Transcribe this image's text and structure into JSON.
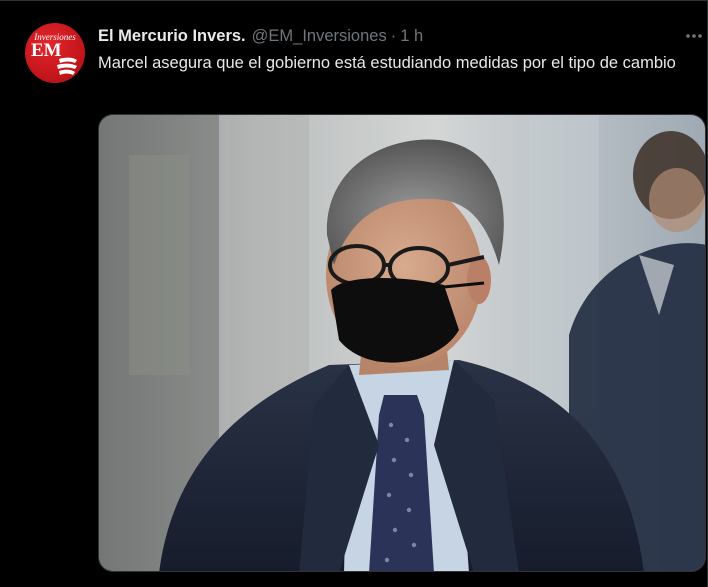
{
  "tweet": {
    "author": {
      "display_name": "El Mercurio Invers.",
      "handle": "@EM_Inversiones",
      "avatar": {
        "top_text": "Inversiones",
        "logo_text": "EM"
      }
    },
    "separator": "·",
    "time": "1 h",
    "text": "Marcel asegura que el gobierno está estudiando medidas por el tipo de cambio",
    "more_icon": "more-horizontal-icon",
    "media": {
      "kind": "photo",
      "description_icon": "photo"
    }
  },
  "colors": {
    "background": "#000000",
    "text_primary": "#e7e9ea",
    "text_secondary": "#71767b",
    "border": "#2f3336",
    "avatar_red": "#c4161c"
  }
}
